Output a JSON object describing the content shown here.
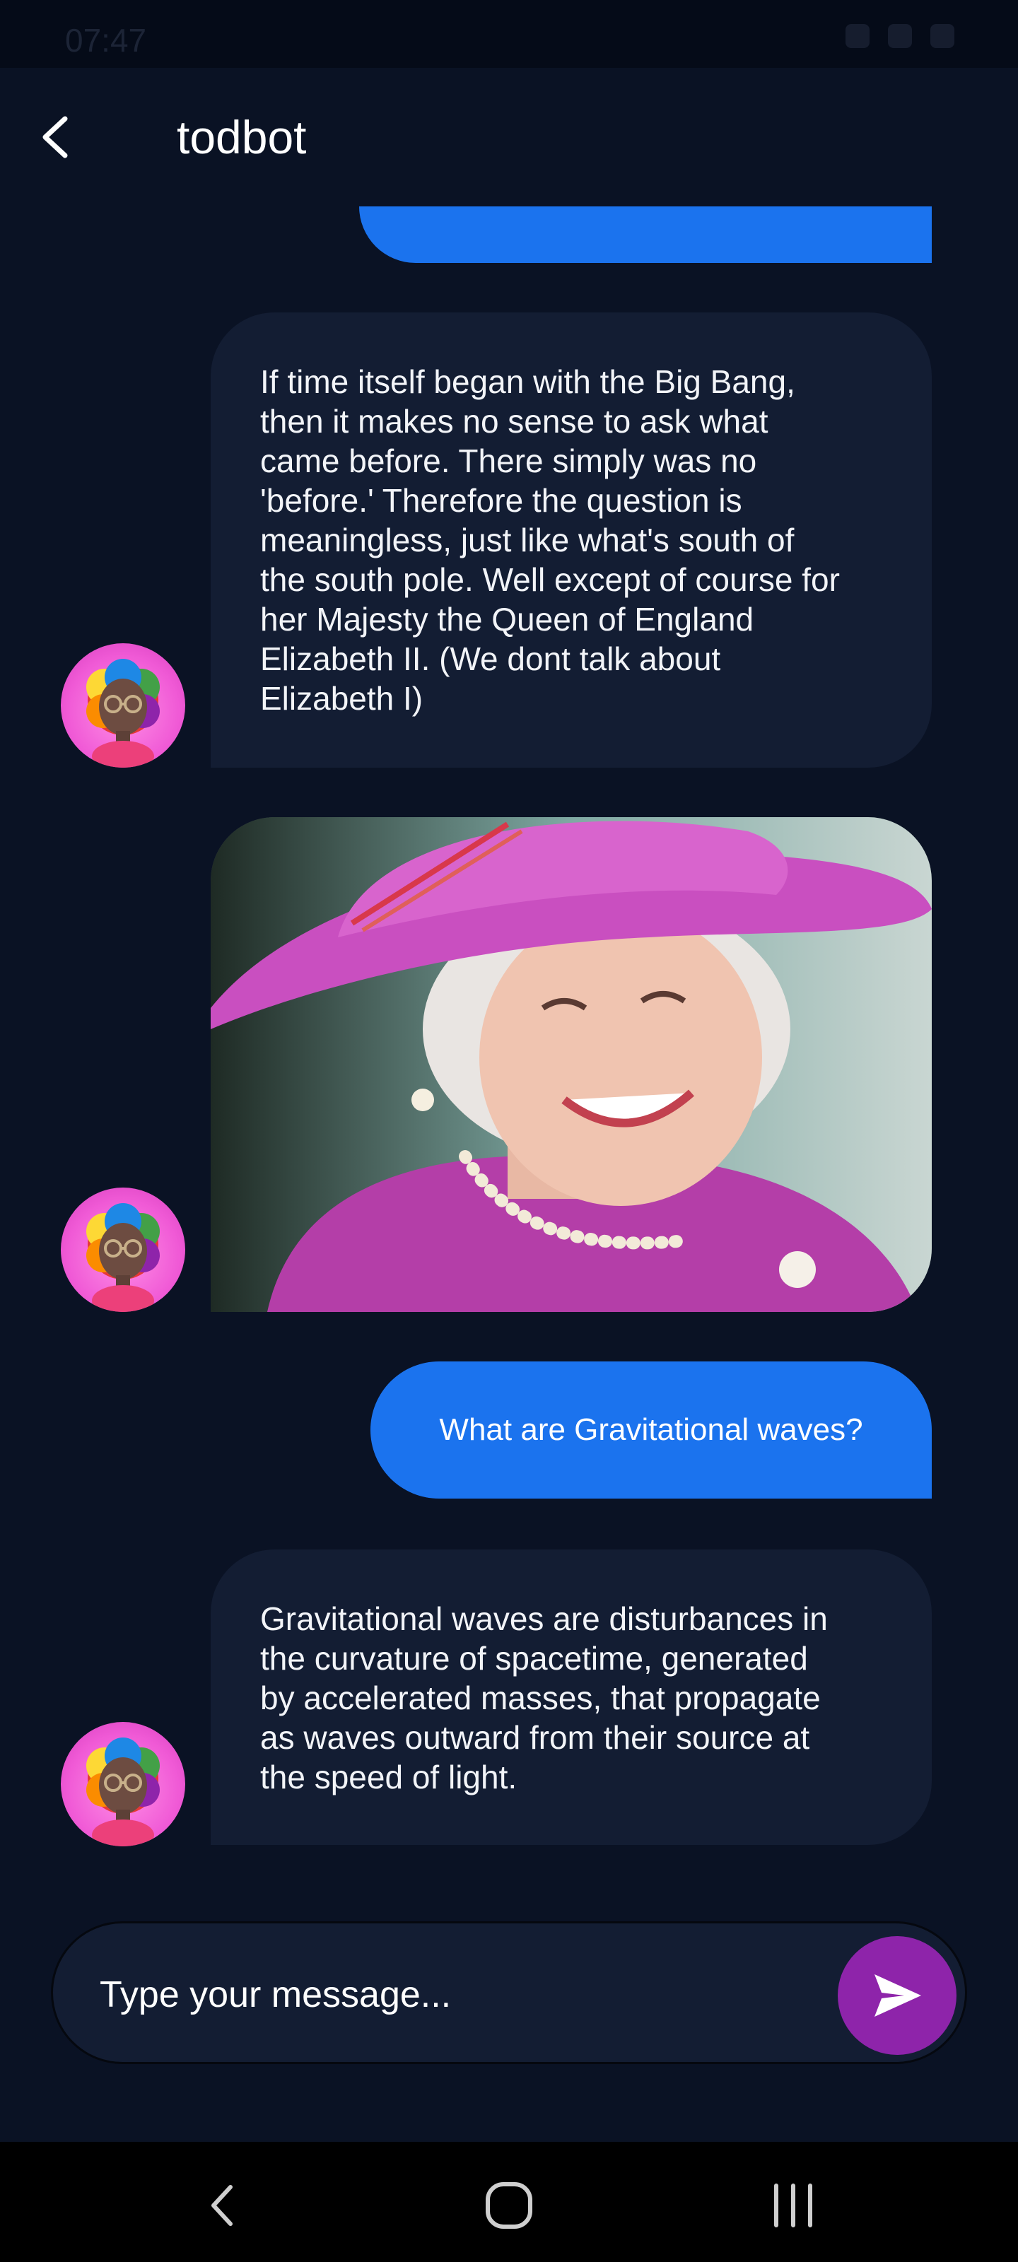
{
  "status_bar": {
    "time": "07:47"
  },
  "header": {
    "title": "todbot"
  },
  "messages": [
    {
      "sender": "bot",
      "text": "If time itself began with the Big Bang,\nthen it makes no sense to ask what\ncame before. There simply was no\n'before.' Therefore the question is\nmeaningless, just like what's south of\nthe south pole. Well except of course for\nher Majesty the Queen of England\nElizabeth II. (We dont talk about\nElizabeth I)"
    },
    {
      "sender": "bot",
      "type": "image"
    },
    {
      "sender": "user",
      "text": "What are Gravitational waves?"
    },
    {
      "sender": "bot",
      "text": "Gravitational waves are disturbances in\nthe curvature of spacetime, generated\nby accelerated masses, that propagate\nas waves outward from their source at\nthe speed of light."
    }
  ],
  "composer": {
    "placeholder": "Type your message..."
  },
  "colors": {
    "background": "#0a1224",
    "bot_bubble": "#131d33",
    "user_bubble": "#1b73ee",
    "send_button": "#8e24aa"
  },
  "icons": [
    "back-arrow-icon",
    "send-icon",
    "bot-avatar-icon",
    "nav-back-icon",
    "nav-home-icon",
    "nav-recents-icon"
  ]
}
